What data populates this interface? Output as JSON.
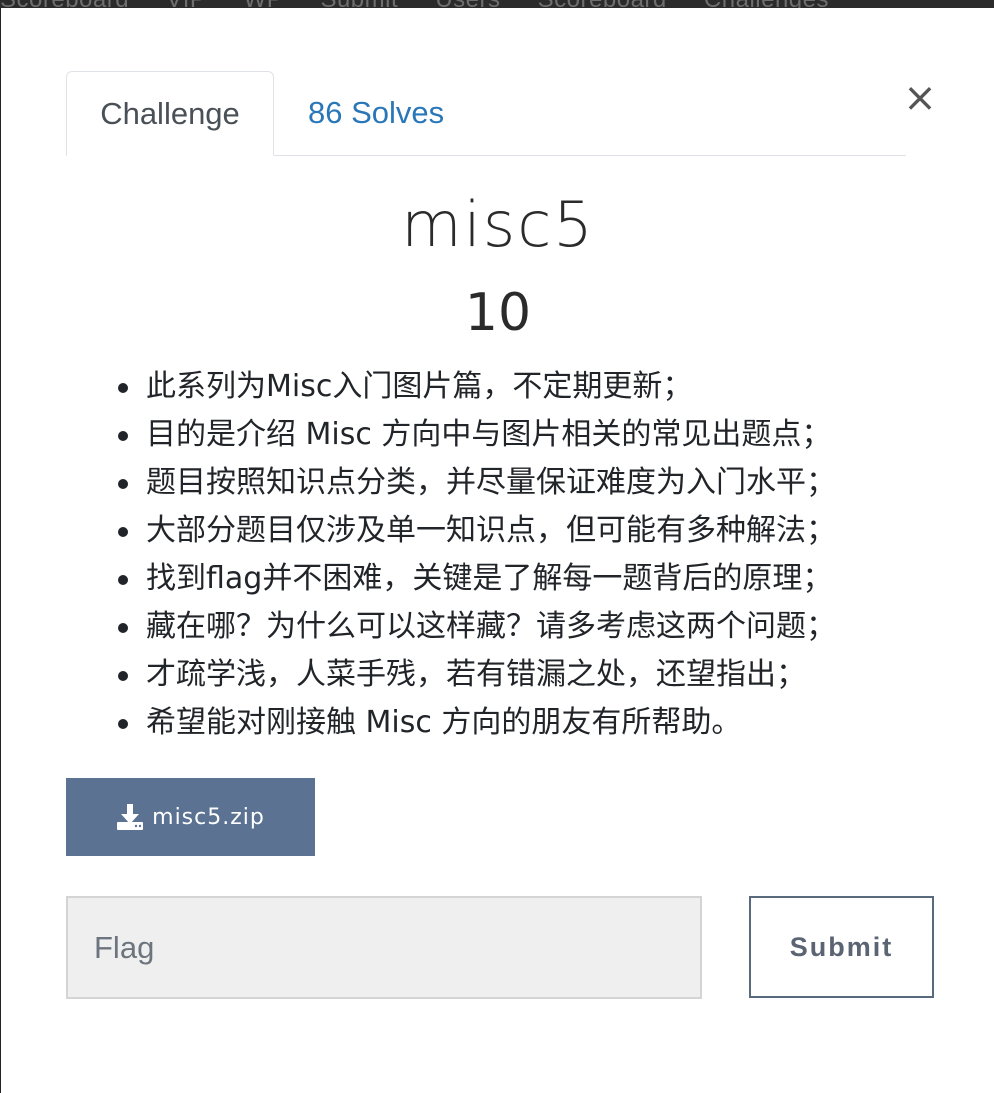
{
  "background_nav": {
    "items": [
      "Scoreboard",
      "VIP",
      "WP",
      "Submit",
      "Users",
      "Scoreboard",
      "Challenges"
    ]
  },
  "modal": {
    "close_symbol": "×",
    "tabs": [
      {
        "label": "Challenge",
        "active": true
      },
      {
        "label": "86 Solves",
        "active": false
      }
    ],
    "challenge": {
      "name": "misc5",
      "points": "10",
      "description": [
        "此系列为Misc入门图片篇，不定期更新；",
        "目的是介绍 Misc 方向中与图片相关的常见出题点；",
        "题目按照知识点分类，并尽量保证难度为入门水平；",
        "大部分题目仅涉及单一知识点，但可能有多种解法；",
        "找到flag并不困难，关键是了解每一题背后的原理；",
        "藏在哪？为什么可以这样藏？请多考虑这两个问题；",
        "才疏学浅，人菜手残，若有错漏之处，还望指出；",
        "希望能对刚接触 Misc 方向的朋友有所帮助。"
      ],
      "file": {
        "icon": "download-icon",
        "label": "misc5.zip"
      }
    },
    "flag_form": {
      "placeholder": "Flag",
      "value": "",
      "submit_label": "Submit"
    }
  },
  "colors": {
    "tab_link": "#2a77b8",
    "download_button": "#5b7292",
    "submit_border": "#5a6a7d",
    "input_background": "#efefef"
  }
}
